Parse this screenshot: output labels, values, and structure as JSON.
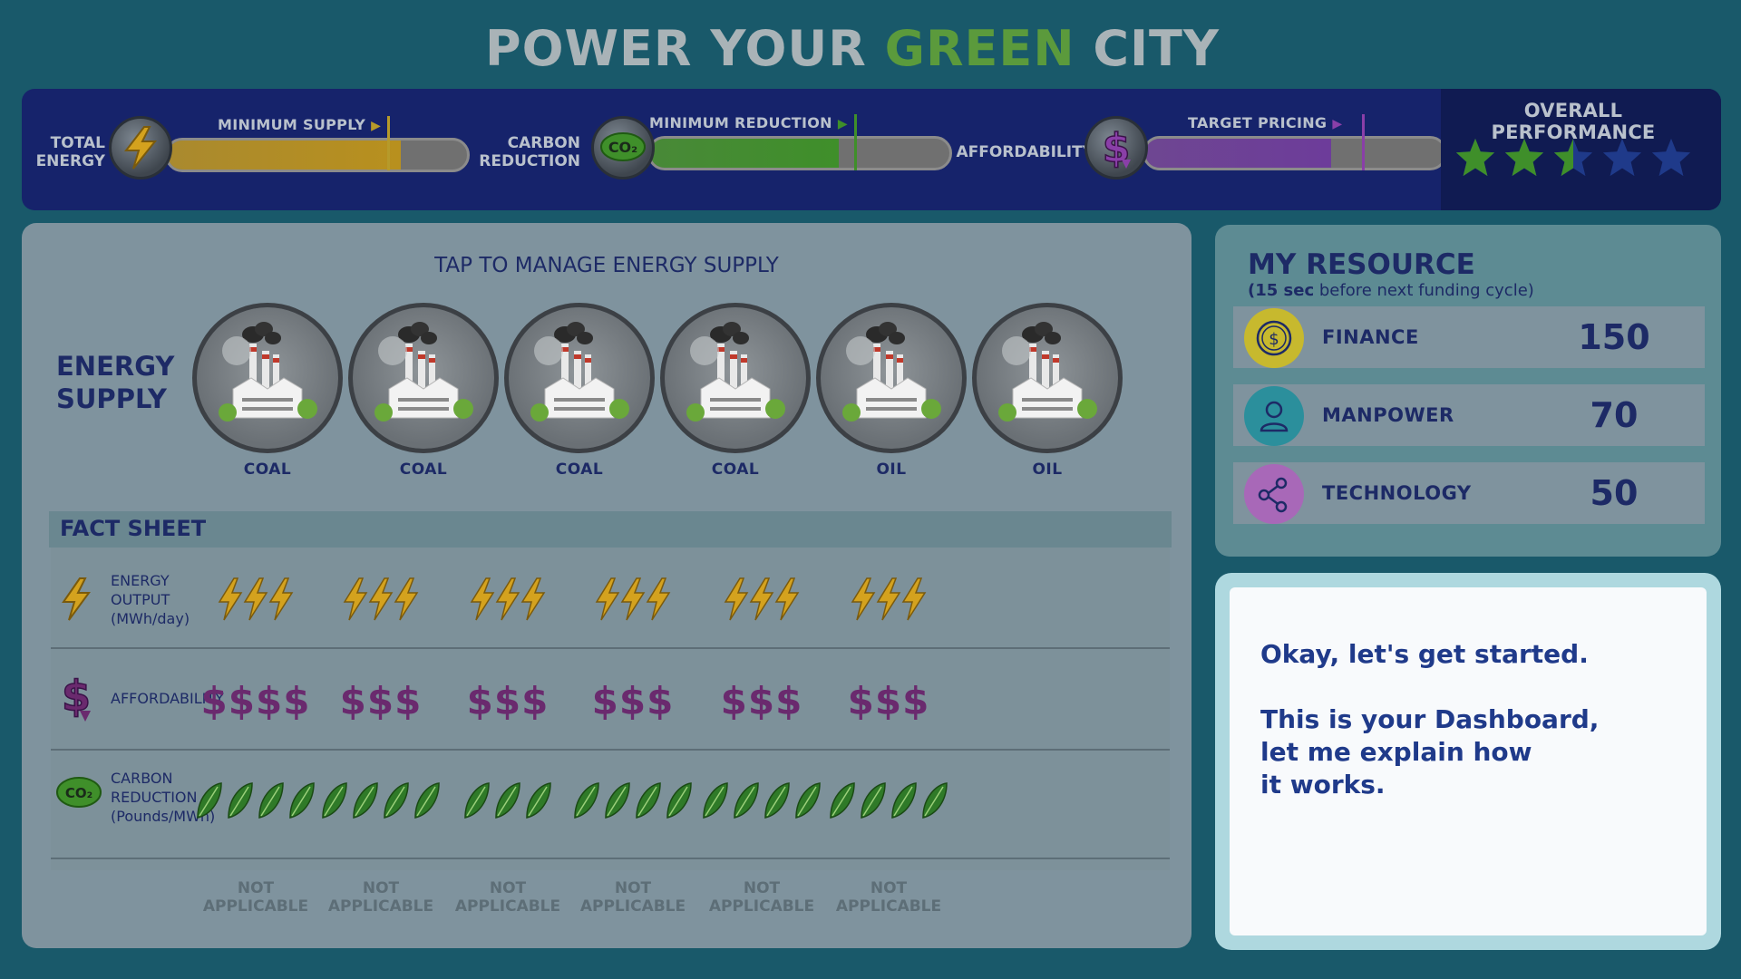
{
  "title": {
    "part1": "POWER YOUR ",
    "part2": "GREEN",
    "part3": " CITY"
  },
  "hud": {
    "total_energy": {
      "label_line1": "TOTAL",
      "label_line2": "ENERGY",
      "cap": "MINIMUM SUPPLY",
      "fill_fraction": 0.78,
      "target_fraction": 0.73,
      "icon": "lightning-icon"
    },
    "carbon_reduction": {
      "label_line1": "CARBON",
      "label_line2": "REDUCTION",
      "cap": "MINIMUM REDUCTION",
      "fill_fraction": 0.63,
      "target_fraction": 0.68,
      "icon": "co2-cloud-icon"
    },
    "affordability": {
      "label": "AFFORDABILITY",
      "cap": "TARGET PRICING",
      "fill_fraction": 0.62,
      "target_fraction": 0.72,
      "icon": "dollar-icon"
    },
    "performance": {
      "title": "OVERALL PERFORMANCE",
      "rating": 2.5,
      "max": 5
    }
  },
  "main": {
    "manage_title": "TAP TO MANAGE ENERGY SUPPLY",
    "energy_supply_line1": "ENERGY",
    "energy_supply_line2": "SUPPLY",
    "plants": [
      "COAL",
      "COAL",
      "COAL",
      "COAL",
      "OIL",
      "OIL"
    ],
    "fact_sheet": {
      "title": "FACT SHEET",
      "energy_label": [
        "ENERGY",
        "OUTPUT",
        "(MWh/day)"
      ],
      "energy_bolts": [
        3,
        3,
        3,
        3,
        3,
        3
      ],
      "afford_label": "AFFORDABILITY",
      "afford_values": [
        "$$$$",
        "$$$",
        "$$$",
        "$$$",
        "$$$",
        "$$$"
      ],
      "carbon_label": [
        "CARBON",
        "REDUCTION",
        "(Pounds/MWh)"
      ],
      "carbon_leaves": [
        4,
        4,
        3,
        4,
        4,
        4
      ],
      "na_line1": "NOT",
      "na_line2": "APPLICABLE"
    }
  },
  "resources": {
    "title": "MY RESOURCE",
    "sub_bold": "(15 sec",
    "sub_rest": " before next funding cycle)",
    "items": [
      {
        "name": "FINANCE",
        "value": "150",
        "icon": "coin-icon",
        "color": "#c7b92e"
      },
      {
        "name": "MANPOWER",
        "value": "70",
        "icon": "person-icon",
        "color": "#2b8f9c"
      },
      {
        "name": "TECHNOLOGY",
        "value": "50",
        "icon": "network-icon",
        "color": "#a868b8"
      }
    ]
  },
  "dialog": {
    "text": "Okay, let's get started.\n\nThis is your Dashboard,\nlet me explain how\n it works."
  },
  "colors": {
    "energy_fill": "#b8901e",
    "carbon_fill": "#3f8f2a",
    "afford_fill": "#6d3c9a",
    "star_on": "#3f8f2a",
    "star_off": "#1f3a8a"
  }
}
